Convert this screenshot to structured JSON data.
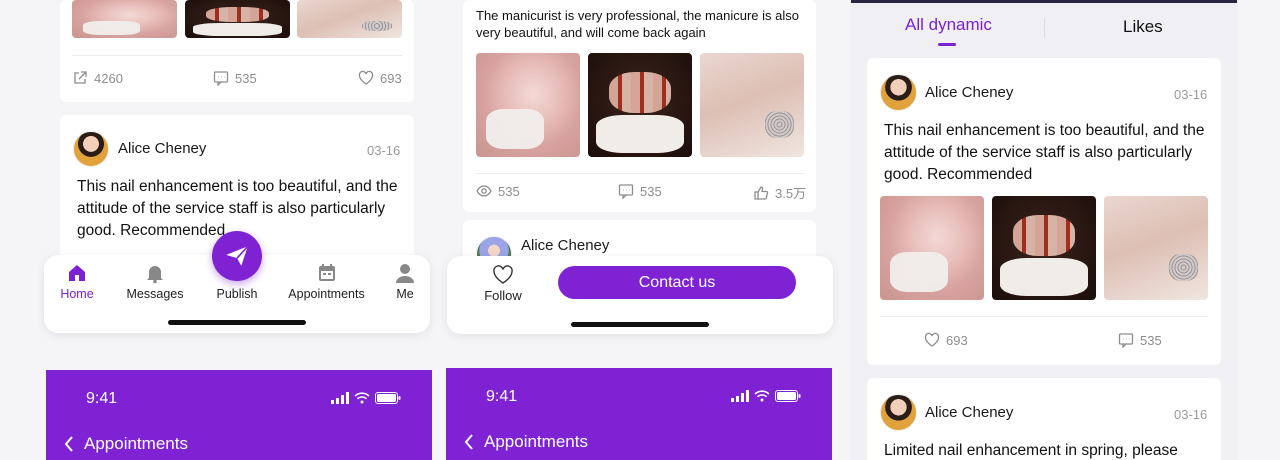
{
  "screen1": {
    "stats_top": {
      "share": "4260",
      "comments": "535",
      "likes": "693"
    },
    "post": {
      "user": "Alice Cheney",
      "date": "03-16",
      "text": "This nail enhancement is too beautiful, and the attitude of the service staff is also particularly good. Recommended"
    },
    "tabbar": {
      "items": [
        {
          "label": "Home",
          "icon": "home-icon",
          "active": true
        },
        {
          "label": "Messages",
          "icon": "bell-icon"
        },
        {
          "label": "Publish",
          "icon": "send-icon"
        },
        {
          "label": "Appointments",
          "icon": "calendar-icon"
        },
        {
          "label": "Me",
          "icon": "user-icon"
        }
      ]
    }
  },
  "screen2": {
    "post_text": "The manicurist is very professional, the manicure is also very beautiful, and will come back again",
    "stats": {
      "views": "535",
      "comments": "535",
      "likes": "3.5万"
    },
    "next_user": "Alice Cheney",
    "follow_label": "Follow",
    "contact_label": "Contact us"
  },
  "screen3": {
    "tabs": [
      "All dynamic",
      "Likes"
    ],
    "post1": {
      "user": "Alice Cheney",
      "date": "03-16",
      "text": "This nail enhancement is too beautiful, and the attitude of the service staff is also particularly good. Recommended",
      "likes": "693",
      "comments": "535"
    },
    "post2": {
      "user": "Alice Cheney",
      "date": "03-16",
      "text": "Limited nail enhancement in spring, please"
    }
  },
  "bottom_screens": [
    {
      "time": "9:41",
      "title": "Appointments"
    },
    {
      "time": "9:41",
      "title": "Appointments"
    }
  ],
  "colors": {
    "accent": "#7e22d4",
    "tab_active": "#7c22d6"
  }
}
